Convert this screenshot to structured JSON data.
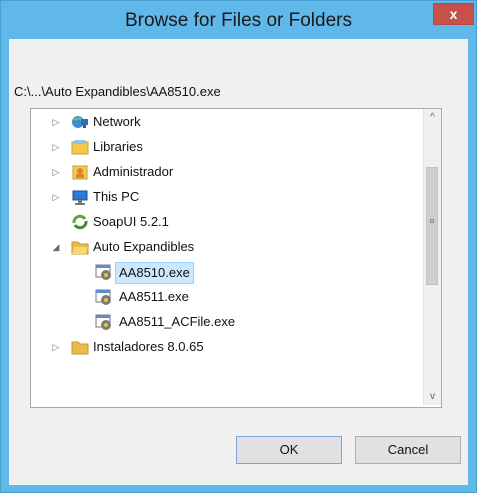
{
  "dialog": {
    "title": "Browse for Files or Folders",
    "close_label": "x",
    "path": "C:\\...\\Auto Expandibles\\AA8510.exe"
  },
  "tree": {
    "items": [
      {
        "label": "Network",
        "icon": "network-icon",
        "expander": "▷"
      },
      {
        "label": "Libraries",
        "icon": "libraries-icon",
        "expander": "▷"
      },
      {
        "label": "Administrador",
        "icon": "user-folder-icon",
        "expander": "▷"
      },
      {
        "label": "This PC",
        "icon": "computer-icon",
        "expander": "▷"
      },
      {
        "label": "SoapUI 5.2.1",
        "icon": "soapui-icon",
        "expander": ""
      },
      {
        "label": "Auto Expandibles",
        "icon": "folder-open-icon",
        "expander": "◢"
      },
      {
        "label": "AA8510.exe",
        "icon": "exe-icon",
        "expander": "",
        "selected": true
      },
      {
        "label": "AA8511.exe",
        "icon": "exe-icon",
        "expander": ""
      },
      {
        "label": "AA8511_ACFile.exe",
        "icon": "exe-icon",
        "expander": ""
      },
      {
        "label": "Instaladores 8.0.65",
        "icon": "folder-icon",
        "expander": "▷"
      }
    ]
  },
  "scrollbar": {
    "up": "^",
    "down": "v",
    "grip": "≡"
  },
  "buttons": {
    "ok": "OK",
    "cancel": "Cancel"
  }
}
